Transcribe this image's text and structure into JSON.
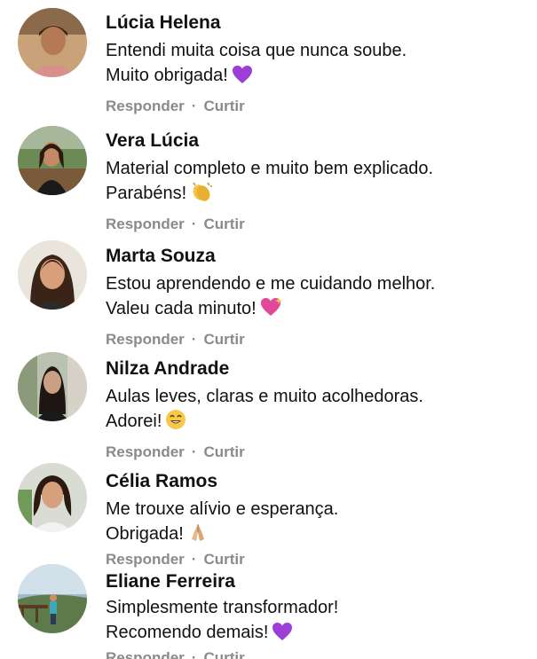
{
  "comments": [
    {
      "name": "Lúcia Helena",
      "line1": "Entendi muita coisa que nunca soube.",
      "line2": "Muito obrigada!",
      "emoji": "purple-heart-icon",
      "reply": "Responder",
      "like": "Curtir"
    },
    {
      "name": "Vera Lúcia",
      "line1": "Material completo e muito bem explicado.",
      "line2": "Parabéns!",
      "emoji": "clapping-hands-icon",
      "reply": "Responder",
      "like": "Curtir"
    },
    {
      "name": "Marta Souza",
      "line1": "Estou aprendendo e me cuidando melhor.",
      "line2": "Valeu cada minuto!",
      "emoji": "sparkling-heart-icon",
      "reply": "Responder",
      "like": "Curtir"
    },
    {
      "name": "Nilza Andrade",
      "line1": "Aulas leves, claras e muito acolhedoras.",
      "line2": "Adorei!",
      "emoji": "smiling-face-icon",
      "reply": "Responder",
      "like": "Curtir"
    },
    {
      "name": "Célia Ramos",
      "line1": "Me trouxe alívio e esperança.",
      "line2": "Obrigada!",
      "emoji": "folded-hands-icon",
      "reply": "Responder",
      "like": "Curtir"
    },
    {
      "name": "Eliane Ferreira",
      "line1": "Simplesmente transformador!",
      "line2": "Recomendo demais!",
      "emoji": "purple-heart-icon",
      "reply": "Responder",
      "like": "Curtir"
    }
  ],
  "separator": "·",
  "colors": {
    "action_text": "#8a8a8a",
    "name_text": "#111111",
    "heart": "#9b3fd6"
  }
}
